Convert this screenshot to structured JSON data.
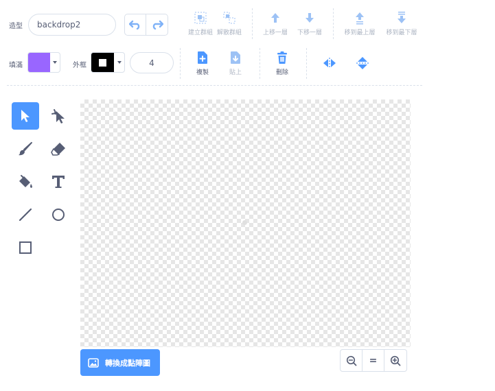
{
  "costume": {
    "label": "造型",
    "name_value": "backdrop2"
  },
  "fill": {
    "label": "填滿",
    "color": "#9966ff"
  },
  "outline": {
    "label": "外框",
    "color": "#000000",
    "width_value": "4"
  },
  "group_buttons": {
    "group": "建立群組",
    "ungroup": "解散群組",
    "forward": "上移一層",
    "backward": "下移一層",
    "front": "移到最上層",
    "back": "移到最下層"
  },
  "edit_buttons": {
    "copy": "複製",
    "paste": "貼上",
    "delete": "刪除"
  },
  "convert_button": {
    "label": "轉換成點陣圖"
  },
  "zoom": {
    "out": "zoom-out",
    "reset": "=",
    "in": "zoom-in"
  },
  "colors": {
    "accent": "#4c97ff",
    "text": "#575e75",
    "disabled": "#adb5c3"
  }
}
